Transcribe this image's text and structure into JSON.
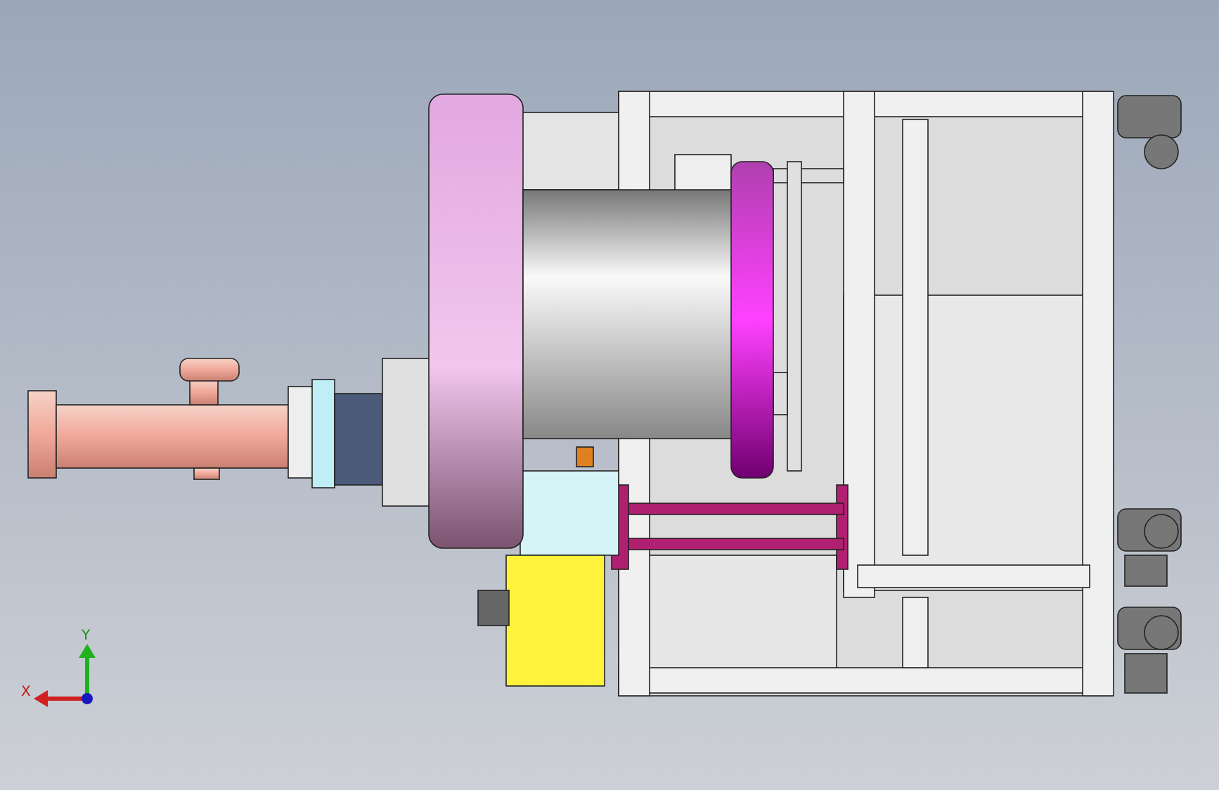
{
  "viewport": {
    "axes": [
      {
        "label": "Y",
        "kind": "y"
      },
      {
        "label": "X",
        "kind": "x"
      }
    ]
  }
}
